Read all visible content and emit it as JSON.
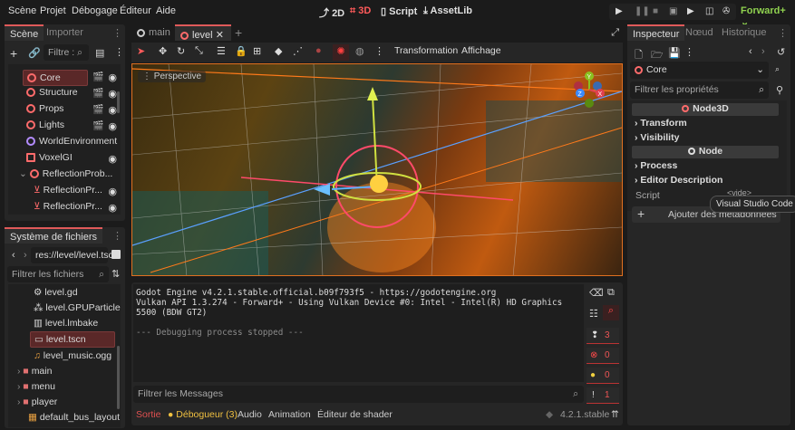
{
  "menu": [
    "Scène",
    "Projet",
    "Débogage",
    "Éditeur",
    "Aide"
  ],
  "workspaces": [
    {
      "label": "2D",
      "icon": "2d-icon"
    },
    {
      "label": "3D",
      "icon": "3d-icon",
      "active": true
    },
    {
      "label": "Script",
      "icon": "script-icon"
    },
    {
      "label": "AssetLib",
      "icon": "download-icon"
    }
  ],
  "renderer": "Forward+",
  "scene_dock": {
    "tabs": [
      "Scène",
      "Importer"
    ],
    "filter_placeholder": "Filtre :",
    "nodes": [
      {
        "label": "Core",
        "selected": true
      },
      {
        "label": "Structure"
      },
      {
        "label": "Props"
      },
      {
        "label": "Lights"
      },
      {
        "label": "WorldEnvironment"
      },
      {
        "label": "VoxelGI"
      },
      {
        "label": "ReflectionProb..."
      },
      {
        "label": "ReflectionPr..."
      },
      {
        "label": "ReflectionPr..."
      }
    ]
  },
  "filesystem": {
    "title": "Système de fichiers",
    "path": "res://level/level.tsc",
    "filter_placeholder": "Filtrer les fichiers",
    "items": [
      {
        "label": "level.gd"
      },
      {
        "label": "level.GPUParticle..."
      },
      {
        "label": "level.lmbake"
      },
      {
        "label": "level.tscn",
        "selected": true
      },
      {
        "label": "level_music.ogg"
      },
      {
        "label": "main"
      },
      {
        "label": "menu"
      },
      {
        "label": "player"
      },
      {
        "label": "default_bus_layout..."
      }
    ]
  },
  "scene_tabs": [
    "main",
    "level"
  ],
  "viewport": {
    "menus": [
      "Transformation",
      "Affichage"
    ],
    "perspective": "Perspective",
    "gizmo_axes": [
      "Y",
      "Z",
      "X"
    ]
  },
  "output": {
    "lines": [
      "Godot Engine v4.2.1.stable.official.b09f793f5 - https://godotengine.org",
      "Vulkan API 1.3.274 - Forward+ - Using Vulkan Device #0: Intel - Intel(R) HD Graphics 5500 (BDW GT2)",
      "",
      "--- Debugging process stopped ---"
    ],
    "filter_placeholder": "Filtrer les Messages",
    "counts": {
      "messages": "3",
      "errors": "0",
      "warnings": "0",
      "editor": "1"
    }
  },
  "bottom_tabs": [
    "Sortie",
    "Débogueur (3)",
    "Audio",
    "Animation",
    "Éditeur de shader"
  ],
  "version": "4.2.1.stable",
  "inspector": {
    "tabs": [
      "Inspecteur",
      "Nœud",
      "Historique"
    ],
    "node": "Core",
    "filter_placeholder": "Filtrer les propriétés",
    "sections": [
      "Node3D",
      "Node"
    ],
    "groups1": [
      "Transform",
      "Visibility"
    ],
    "groups2": [
      "Process",
      "Editor Description"
    ],
    "script_label": "Script",
    "script_value": "<vide>",
    "add_meta": "Ajouter des métadonnées",
    "tooltip": "Visual Studio Code"
  }
}
